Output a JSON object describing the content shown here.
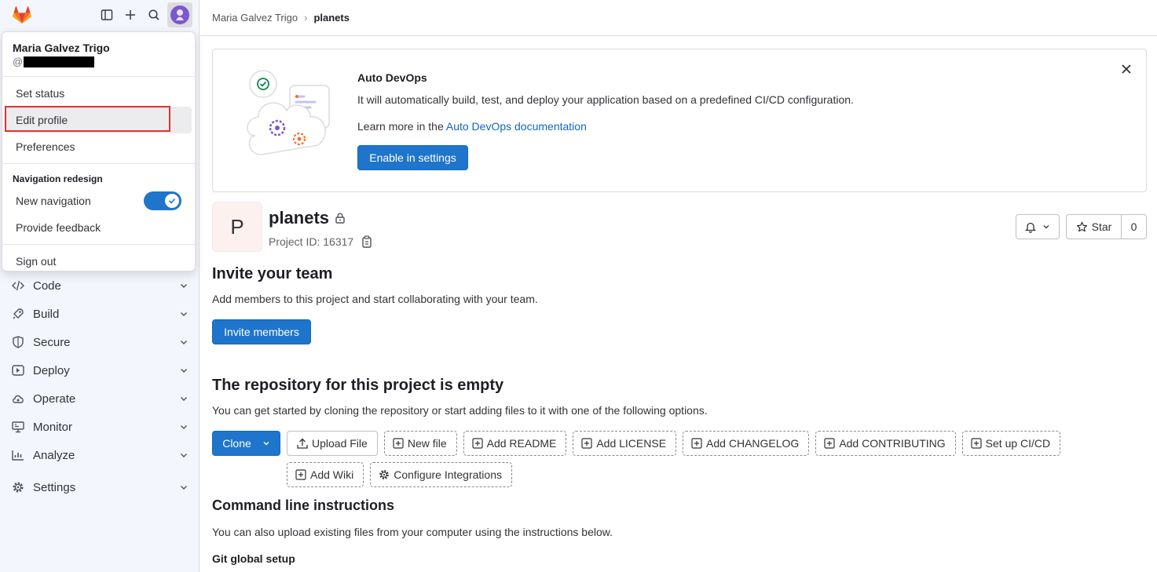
{
  "breadcrumb": {
    "parent": "Maria Galvez Trigo",
    "current": "planets"
  },
  "user_menu": {
    "name": "Maria Galvez Trigo",
    "handle_prefix": "@",
    "items": [
      "Set status",
      "Edit profile",
      "Preferences"
    ],
    "group_title": "Navigation redesign",
    "new_navigation_label": "New navigation",
    "new_navigation_on": true,
    "feedback_label": "Provide feedback",
    "sign_out_label": "Sign out"
  },
  "sidebar": {
    "nav_items": [
      "Code",
      "Build",
      "Secure",
      "Deploy",
      "Operate",
      "Monitor",
      "Analyze"
    ],
    "settings_label": "Settings"
  },
  "banner": {
    "title": "Auto DevOps",
    "text": "It will automatically build, test, and deploy your application based on a predefined CI/CD configuration.",
    "learn_prefix": "Learn more in the ",
    "learn_link": "Auto DevOps documentation",
    "button_label": "Enable in settings"
  },
  "project": {
    "avatar_letter": "P",
    "name": "planets",
    "id_text": "Project ID: 16317",
    "star_label": "Star",
    "star_count": "0"
  },
  "invite": {
    "title": "Invite your team",
    "text": "Add members to this project and start collaborating with your team.",
    "button_label": "Invite members"
  },
  "repo": {
    "title": "The repository for this project is empty",
    "text": "You can get started by cloning the repository or start adding files to it with one of the following options.",
    "clone_label": "Clone",
    "upload_label": "Upload File",
    "options_row1": [
      "New file",
      "Add README",
      "Add LICENSE",
      "Add CHANGELOG",
      "Add CONTRIBUTING",
      "Set up CI/CD"
    ],
    "add_wiki_label": "Add Wiki",
    "configure_label": "Configure Integrations"
  },
  "cli": {
    "title": "Command line instructions",
    "text": "You can also upload existing files from your computer using the instructions below.",
    "git_setup_label": "Git global setup"
  },
  "colors": {
    "primary": "#1f75cb",
    "highlight": "#e0342c",
    "sidebar_bg": "#f3f6fc"
  }
}
